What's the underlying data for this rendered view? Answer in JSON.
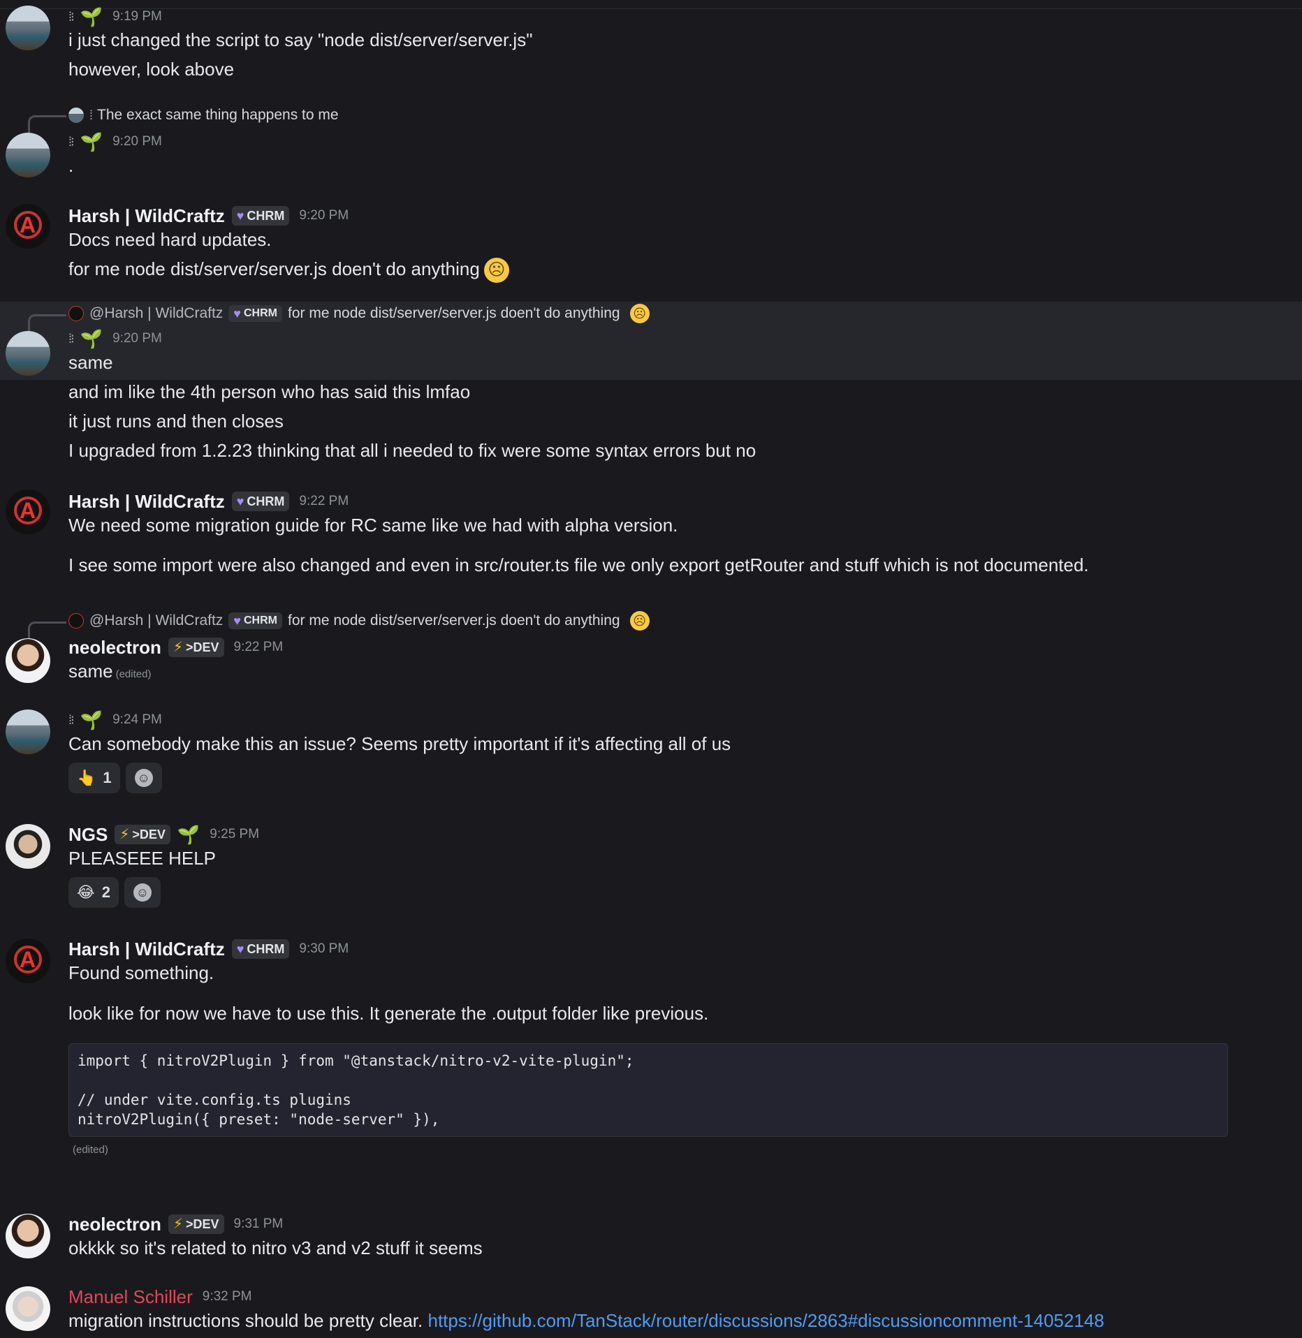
{
  "m1": {
    "time": "9:19 PM",
    "lines": [
      "i just changed the script to say \"node dist/server/server.js\"",
      "however, look above"
    ]
  },
  "m2": {
    "reply_text": "The exact same thing happens to me",
    "time": "9:20 PM",
    "lines": [
      "."
    ]
  },
  "m3": {
    "user": "Harsh | WildCraftz",
    "tag": "CHRM",
    "time": "9:20 PM",
    "lines": [
      "Docs need hard updates.",
      "for me node dist/server/server.js doen't do anything"
    ]
  },
  "m4": {
    "reply_user": "@Harsh | WildCraftz",
    "reply_tag": "CHRM",
    "reply_text": "for me node dist/server/server.js doen't do anything",
    "time": "9:20 PM",
    "lines": [
      "same",
      "and im like the 4th person who has said this lmfao",
      "it just runs and then closes",
      "I upgraded from 1.2.23 thinking that all i needed to fix were some syntax errors but no"
    ]
  },
  "m5": {
    "user": "Harsh | WildCraftz",
    "tag": "CHRM",
    "time": "9:22 PM",
    "lines": [
      "We need some migration guide for RC same like we had with alpha version.",
      "I see some import were also changed and even in src/router.ts file we only export getRouter and stuff which is not documented."
    ]
  },
  "m6": {
    "reply_user": "@Harsh | WildCraftz",
    "reply_tag": "CHRM",
    "reply_text": "for me node dist/server/server.js doen't do anything",
    "user": "neolectron",
    "tag": ">DEV",
    "time": "9:22 PM",
    "line": "same",
    "edited": "(edited)"
  },
  "m7": {
    "time": "9:24 PM",
    "line": "Can somebody make this an issue? Seems pretty important if it's affecting all of us",
    "reaction_emoji": "👆",
    "reaction_count": "1"
  },
  "m8": {
    "user": "NGS",
    "tag": ">DEV",
    "time": "9:25 PM",
    "line": "PLEASEEE HELP",
    "reaction_emoji": "😂",
    "reaction_count": "2"
  },
  "m9": {
    "user": "Harsh | WildCraftz",
    "tag": "CHRM",
    "time": "9:30 PM",
    "lines": [
      "Found something.",
      "look like for now we have to use this. It generate the .output folder like previous."
    ],
    "code": [
      "import { nitroV2Plugin } from \"@tanstack/nitro-v2-vite-plugin\";",
      "",
      "// under vite.config.ts plugins",
      "nitroV2Plugin({ preset: \"node-server\" }),"
    ],
    "edited": "(edited)"
  },
  "m10": {
    "user": "neolectron",
    "tag": ">DEV",
    "time": "9:31 PM",
    "line": "okkkk so it's related to nitro v3 and v2 stuff it seems"
  },
  "m11": {
    "user": "Manuel Schiller",
    "time": "9:32 PM",
    "text": "migration instructions should be pretty clear.",
    "link": "https://github.com/TanStack/router/discussions/2863#discussioncomment-14052148"
  },
  "colors": {
    "background": "#1a1a1e",
    "link": "#4f9cf5",
    "manuel_name": "#e0485a",
    "badge_heart": "#a78bfa",
    "badge_bolt": "#f5c518",
    "sprout": "#4caf50"
  },
  "icons": {
    "heart": "♥",
    "bolt": "⚡",
    "sprout": "🌱",
    "sad": "☹",
    "smile": "☺"
  }
}
